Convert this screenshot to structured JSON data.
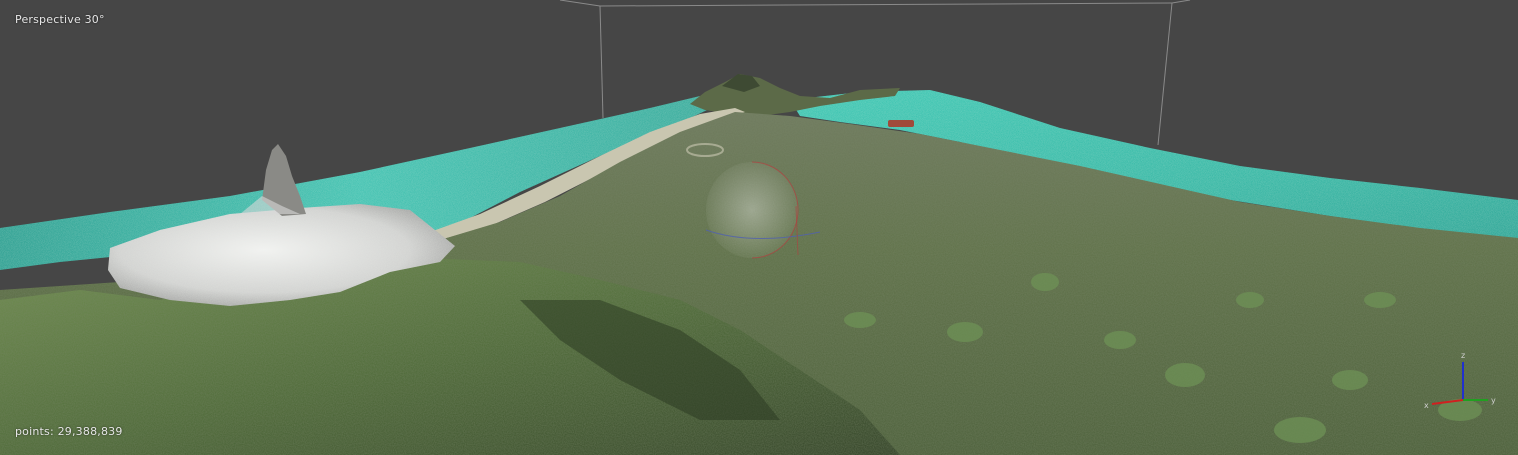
{
  "viewport": {
    "projection_label": "Perspective 30°",
    "point_count_label": "points: 29,388,839",
    "background_color": "#464646",
    "water_color": "#2fb3a0",
    "vegetation_color": "#5a6e45",
    "rock_color": "#d8d8d8"
  },
  "axis_gizmo": {
    "x_label": "x",
    "y_label": "y",
    "z_label": "z",
    "x_color": "#d02020",
    "y_color": "#20a020",
    "z_color": "#2030d0"
  },
  "pivot": {
    "icon": "orbit-sphere-icon"
  }
}
